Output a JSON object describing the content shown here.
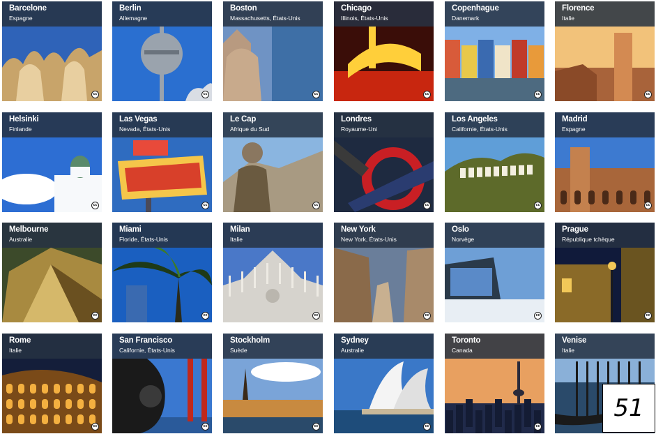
{
  "cc_label": "cc",
  "page_number": "51",
  "tiles": [
    {
      "city": "Barcelone",
      "country": "Espagne",
      "sky": "#2f63b8",
      "ground": "#c8a46a",
      "accent": "#e8cfa0",
      "icon": "casa-mila-icon"
    },
    {
      "city": "Berlin",
      "country": "Allemagne",
      "sky": "#2a6fd0",
      "ground": "#d9dde4",
      "accent": "#9aa3ad",
      "icon": "tv-tower-icon"
    },
    {
      "city": "Boston",
      "country": "Massachusetts, États-Unis",
      "sky": "#6f93c4",
      "ground": "#b89a80",
      "accent": "#3e6fa6",
      "icon": "church-tower-icon"
    },
    {
      "city": "Chicago",
      "country": "Illinois, États-Unis",
      "sky": "#3a0d08",
      "ground": "#c8260f",
      "accent": "#ffcf3a",
      "icon": "chicago-theatre-sign-icon"
    },
    {
      "city": "Copenhague",
      "country": "Danemark",
      "sky": "#7fb0e6",
      "ground": "#4d6a80",
      "accent": "#d85b3a",
      "icon": "nyhavn-houses-icon"
    },
    {
      "city": "Florence",
      "country": "Italie",
      "sky": "#f2c27a",
      "ground": "#a8633a",
      "accent": "#d38a52",
      "icon": "duomo-icon"
    },
    {
      "city": "Helsinki",
      "country": "Finlande",
      "sky": "#2d6ed3",
      "ground": "#eef1f5",
      "accent": "#f7f9fb",
      "icon": "cathedral-icon"
    },
    {
      "city": "Las Vegas",
      "country": "Nevada, États-Unis",
      "sky": "#2f6cc0",
      "ground": "#d8402a",
      "accent": "#f5c64a",
      "icon": "welcome-sign-icon"
    },
    {
      "city": "Le Cap",
      "country": "Afrique du Sud",
      "sky": "#8ab5e0",
      "ground": "#8a7760",
      "accent": "#6a5a40",
      "icon": "statue-icon"
    },
    {
      "city": "Londres",
      "country": "Royaume-Uni",
      "sky": "#1e2a40",
      "ground": "#c91f24",
      "accent": "#2a3c70",
      "icon": "underground-sign-icon"
    },
    {
      "city": "Los Angeles",
      "country": "Californie, États-Unis",
      "sky": "#5f9ed8",
      "ground": "#5d6a2a",
      "accent": "#f3efe0",
      "icon": "hollywood-sign-icon"
    },
    {
      "city": "Madrid",
      "country": "Espagne",
      "sky": "#3d7ad0",
      "ground": "#a8663a",
      "accent": "#c4814e",
      "icon": "bullring-icon"
    },
    {
      "city": "Melbourne",
      "country": "Australie",
      "sky": "#3c4a2a",
      "ground": "#a88a40",
      "accent": "#d5b86a",
      "icon": "federation-square-icon"
    },
    {
      "city": "Miami",
      "country": "Floride, États-Unis",
      "sky": "#1a5fc0",
      "ground": "#1e3a18",
      "accent": "#3e7a2a",
      "icon": "palm-tree-icon"
    },
    {
      "city": "Milan",
      "country": "Italie",
      "sky": "#4a78c8",
      "ground": "#d6d3cd",
      "accent": "#eeebe4",
      "icon": "milan-cathedral-icon"
    },
    {
      "city": "New York",
      "country": "New York, États-Unis",
      "sky": "#6a7e9a",
      "ground": "#8a6a4a",
      "accent": "#c8b090",
      "icon": "skyscrapers-icon"
    },
    {
      "city": "Oslo",
      "country": "Norvège",
      "sky": "#6e9fd6",
      "ground": "#e8eef4",
      "accent": "#2a3a4a",
      "icon": "opera-house-icon"
    },
    {
      "city": "Prague",
      "country": "République tchèque",
      "sky": "#101a3a",
      "ground": "#8a6a28",
      "accent": "#f2c858",
      "icon": "street-lamp-icon"
    },
    {
      "city": "Rome",
      "country": "Italie",
      "sky": "#141e3a",
      "ground": "#7a4a18",
      "accent": "#f4b040",
      "icon": "colosseum-icon"
    },
    {
      "city": "San Francisco",
      "country": "Californie, États-Unis",
      "sky": "#3a78d0",
      "ground": "#c0281c",
      "accent": "#1a1a1a",
      "icon": "golden-gate-icon"
    },
    {
      "city": "Stockholm",
      "country": "Suède",
      "sky": "#7aa4d8",
      "ground": "#2a4a6a",
      "accent": "#c88a40",
      "icon": "old-town-icon"
    },
    {
      "city": "Sydney",
      "country": "Australie",
      "sky": "#3a78c8",
      "ground": "#1e4c7a",
      "accent": "#f4f4f4",
      "icon": "opera-sails-icon"
    },
    {
      "city": "Toronto",
      "country": "Canada",
      "sky": "#e8a060",
      "ground": "#202a4a",
      "accent": "#2a2a3a",
      "icon": "cn-tower-icon"
    },
    {
      "city": "Venise",
      "country": "Italie",
      "sky": "#8ab0d8",
      "ground": "#2a4a6a",
      "accent": "#1a1a1a",
      "icon": "gondola-icon"
    }
  ]
}
